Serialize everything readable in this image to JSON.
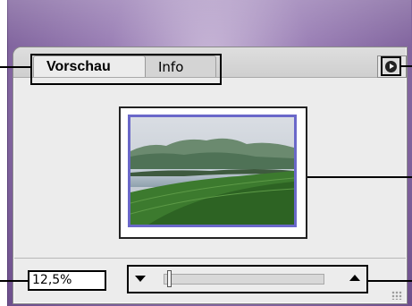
{
  "panel": {
    "tabs": [
      {
        "label": "Vorschau",
        "active": true
      },
      {
        "label": "Info",
        "active": false
      }
    ],
    "menu_icon": "flyout-menu-icon"
  },
  "preview": {
    "description_icon": "landscape-thumbnail",
    "proxy_color": "#6a68c9"
  },
  "footer": {
    "zoom_value": "12,5%",
    "zoom_out_icon": "triangle-down-icon",
    "zoom_in_icon": "triangle-up-icon",
    "zoom_slider_level": 0.03
  },
  "colors": {
    "frame_accent": "#6d4f8c",
    "panel_bg": "#ececec"
  }
}
